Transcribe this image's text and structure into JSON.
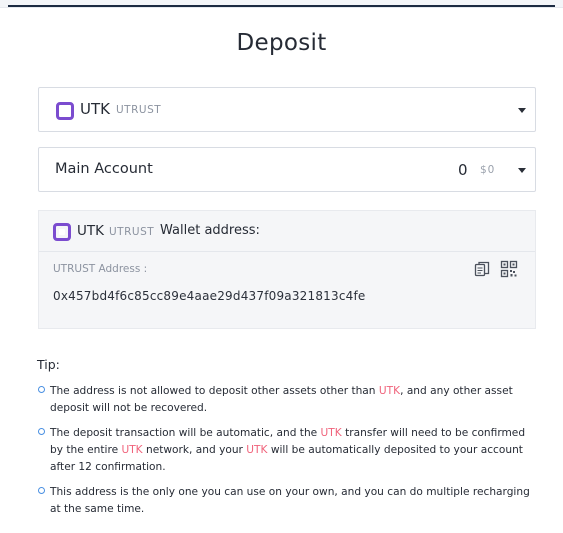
{
  "page": {
    "title": "Deposit"
  },
  "coin_select": {
    "symbol": "UTK",
    "name": "UTRUST"
  },
  "account_select": {
    "name": "Main Account",
    "balance": "0",
    "fiat": "$0"
  },
  "wallet": {
    "symbol": "UTK",
    "name": "UTRUST",
    "label": "Wallet address:",
    "address_label": "UTRUST Address :",
    "address": "0x457bd4f6c85cc89e4aae29d437f09a321813c4fe",
    "icons": {
      "copy": "copy-icon",
      "qr": "qr-code-icon"
    }
  },
  "tips": {
    "title": "Tip:",
    "highlight": "UTK",
    "items": [
      {
        "p1": "The address is not allowed to deposit other assets other than ",
        "h1": "UTK",
        "p2": ", and any other asset deposit will not be recovered."
      },
      {
        "p1": "The deposit transaction will be automatic, and the ",
        "h1": "UTK",
        "p2": " transfer will need to be confirmed by the entire ",
        "h2": "UTK",
        "p3": " network, and your ",
        "h3": "UTK",
        "p4": " will be automatically deposited to your account after 12 confirmation."
      },
      {
        "p1": "This address is the only one you can use on your own, and you can do multiple recharging at the same time."
      }
    ]
  },
  "colors": {
    "brand_purple": "#7b4ccf",
    "highlight_red": "#f0637b",
    "bullet_blue": "#4a90e2"
  }
}
